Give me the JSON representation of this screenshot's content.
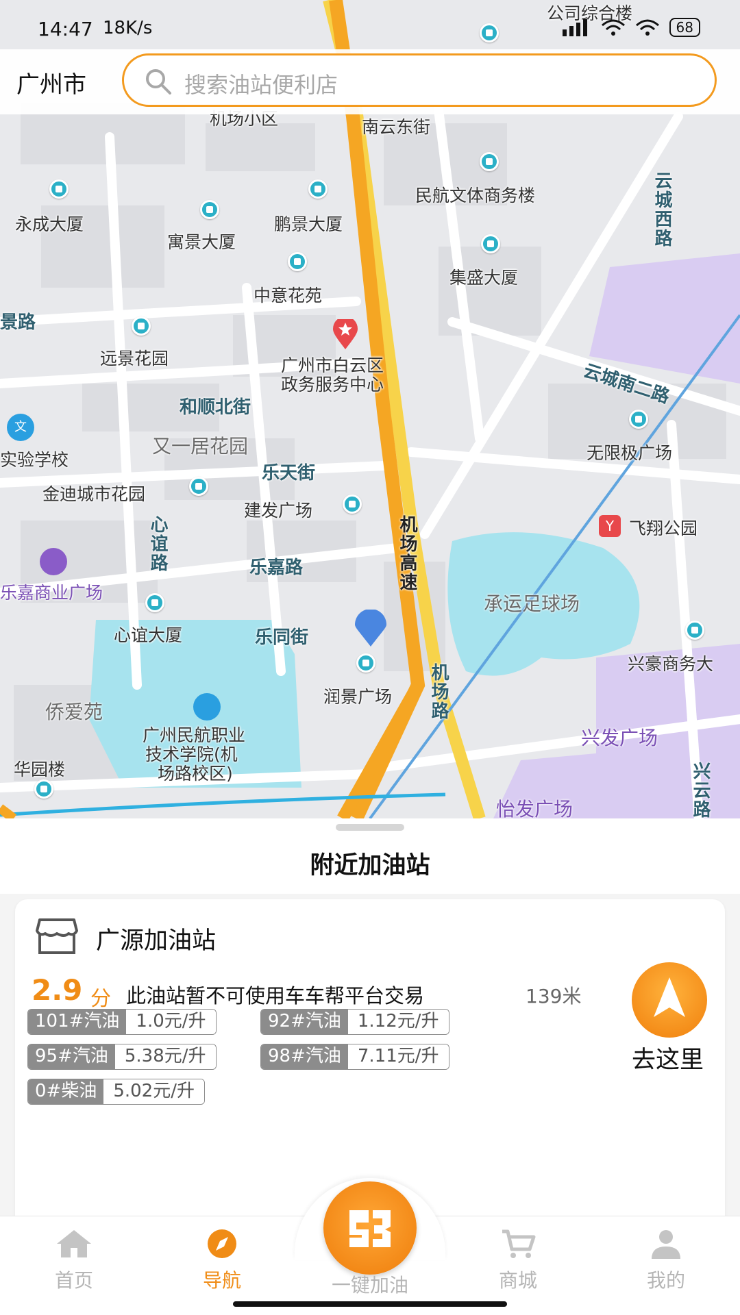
{
  "status_bar": {
    "time": "14:47",
    "speed": "18K/s",
    "battery": "68"
  },
  "search": {
    "city": "广州市",
    "placeholder": "搜索油站便利店"
  },
  "map": {
    "pois": [
      "永成大厦",
      "寓景大厦",
      "鹏景大厦",
      "民航文体商务楼",
      "中意花苑",
      "集盛大厦",
      "远景花园",
      "广州市白云区",
      "政务服务中心",
      "无限极广场",
      "实验学校",
      "金迪城市花园",
      "建发广场",
      "飞翔公园",
      "承运足球场",
      "心谊大厦",
      "润景广场",
      "侨爱苑",
      "广州民航职业",
      "技术学院(机",
      "场路校区)",
      "华园楼",
      "兴豪商务大",
      "兴发广场",
      "怡发广场",
      "乐嘉商业广场",
      "机场小区",
      "南云东街",
      "公司综合楼"
    ],
    "roads": [
      "和顺北街",
      "乐天街",
      "乐嘉路",
      "乐同街",
      "心谊路",
      "机场高速",
      "机场路",
      "云城西路",
      "云城南二路",
      "兴云路",
      "景路"
    ],
    "districts": [
      "又一居花园"
    ]
  },
  "panel": {
    "title": "附近加油站"
  },
  "station": {
    "name": "广源加油站",
    "score": "2.9",
    "score_unit": "分",
    "notice": "此油站暂不可使用车车帮平台交易",
    "distance": "139米",
    "prices": [
      {
        "fuel": "101#汽油",
        "price": "1.0元/升"
      },
      {
        "fuel": "92#汽油",
        "price": "1.12元/升"
      },
      {
        "fuel": "95#汽油",
        "price": "5.38元/升"
      },
      {
        "fuel": "98#汽油",
        "price": "7.11元/升"
      },
      {
        "fuel": "0#柴油",
        "price": "5.02元/升"
      }
    ],
    "go_label": "去这里"
  },
  "tabs": [
    {
      "label": "首页",
      "icon": "home-icon"
    },
    {
      "label": "导航",
      "icon": "compass-icon"
    },
    {
      "label": "一键加油",
      "icon": "logo-icon"
    },
    {
      "label": "商城",
      "icon": "cart-icon"
    },
    {
      "label": "我的",
      "icon": "user-icon"
    }
  ],
  "colors": {
    "accent": "#f08c16",
    "highway": "#f5a623",
    "map_bg": "#e8e9ec"
  }
}
